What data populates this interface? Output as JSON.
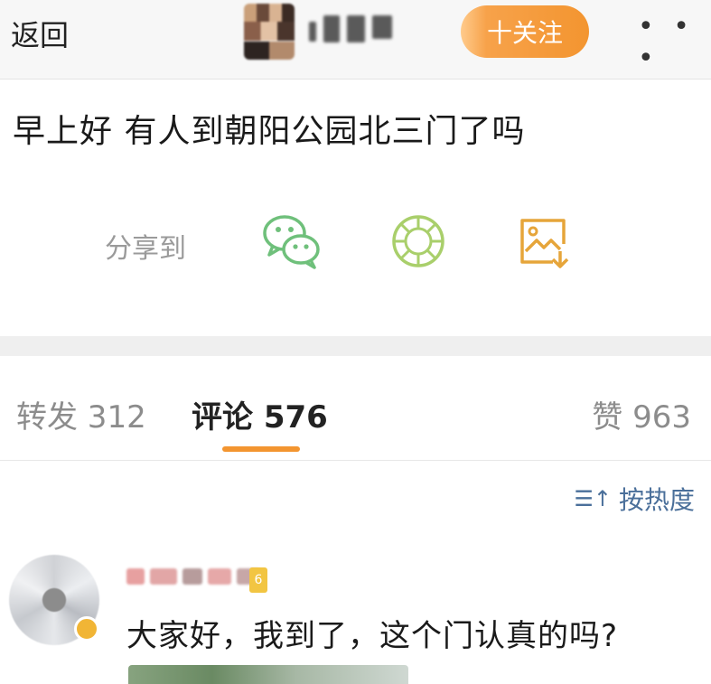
{
  "nav": {
    "back_label": "返回",
    "follow_label": "十关注",
    "more_label": "• • •"
  },
  "post": {
    "text": "早上好 有人到朝阳公园北三门了吗"
  },
  "share": {
    "label": "分享到",
    "targets": [
      "wechat-icon",
      "moments-icon",
      "save-image-icon"
    ]
  },
  "tabs": [
    {
      "label": "转发 312"
    },
    {
      "label": "评论 576"
    },
    {
      "label": "赞 963"
    }
  ],
  "sort": {
    "icon_glyph": "☰↑",
    "label": "按热度"
  },
  "comment": {
    "level_badge": "6",
    "text": "大家好，我到了，这个门认真的吗?"
  },
  "colors": {
    "accent": "#f39530",
    "link_blue": "#4a6f9a",
    "wechat_green": "#6fc07b"
  }
}
